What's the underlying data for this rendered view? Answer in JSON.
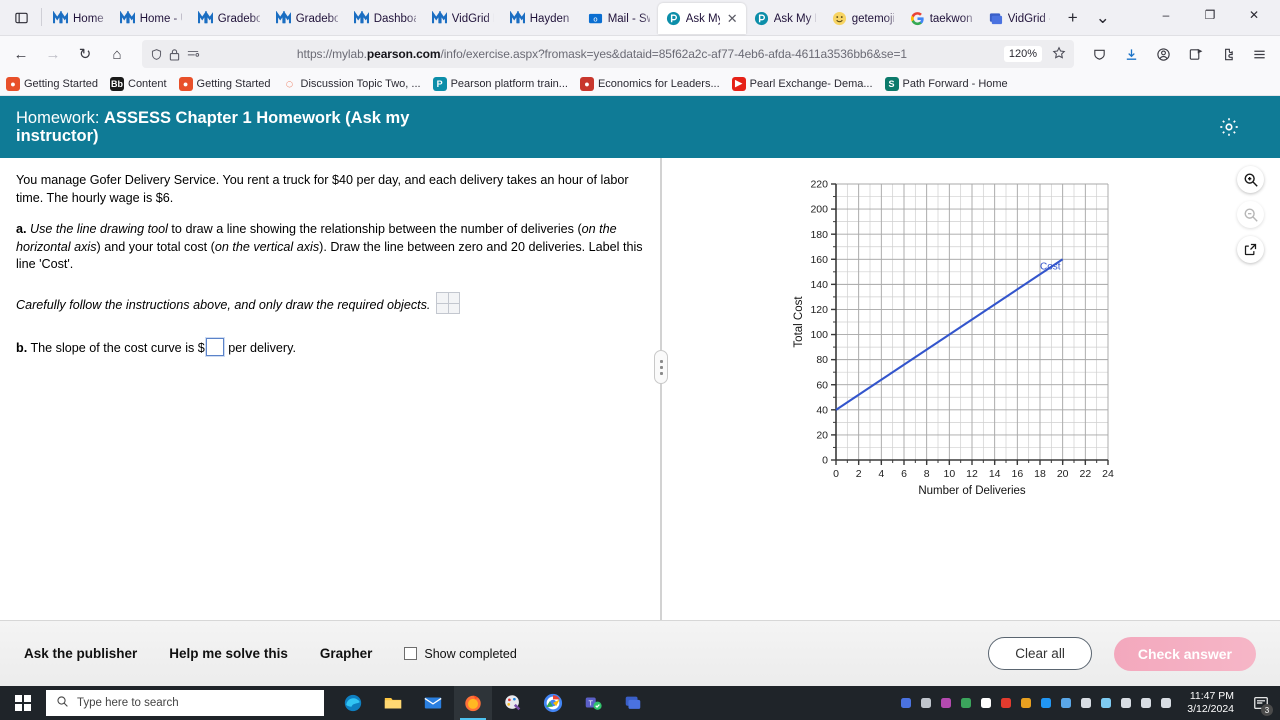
{
  "browser": {
    "tab_list_icon": "tab-list-icon",
    "tabs": [
      {
        "label": "Home",
        "icon": "mcgraw-icon",
        "active": false
      },
      {
        "label": "Home - U",
        "icon": "mcgraw-icon",
        "active": false
      },
      {
        "label": "Gradeboo",
        "icon": "mcgraw-icon",
        "active": false
      },
      {
        "label": "Gradeboo",
        "icon": "mcgraw-icon",
        "active": false
      },
      {
        "label": "Dashboar",
        "icon": "mcgraw-icon",
        "active": false
      },
      {
        "label": "VidGrid P",
        "icon": "mcgraw-icon",
        "active": false
      },
      {
        "label": "Hayden B",
        "icon": "mcgraw-icon",
        "active": false
      },
      {
        "label": "Mail - Sw",
        "icon": "outlook-icon",
        "active": false
      },
      {
        "label": "Ask My",
        "icon": "pearson-icon",
        "active": true
      },
      {
        "label": "Ask My In",
        "icon": "pearson-icon",
        "active": false
      },
      {
        "label": "getemoji",
        "icon": "emoji-icon",
        "active": false
      },
      {
        "label": "taekwond",
        "icon": "google-icon",
        "active": false
      },
      {
        "label": "VidGrid -",
        "icon": "vidgrid-icon",
        "active": false
      }
    ],
    "new_tab_label": "+",
    "tab_menu_label": "⌄",
    "window_controls": {
      "minimize": "–",
      "maximize": "❐",
      "close": "✕"
    },
    "nav": {
      "back": "←",
      "forward": "→",
      "reload": "↻",
      "home": "⌂"
    },
    "url": {
      "protocol": "https://mylab.",
      "domain": "pearson.com",
      "path": "/info/exercise.aspx?fromask=yes&dataid=85f62a2c-af77-4eb6-afda-4611a3536bb6&se=1",
      "full": "https://mylab.pearson.com/info/exercise.aspx?fromask=yes&dataid=85f62a2c-af77-4eb6-afda-4611a3536bb6&se=1"
    },
    "zoom_level": "120%",
    "bookmark_star": "bookmark-star-icon",
    "toolbar_icons": [
      "shield-icon",
      "downloads-icon",
      "account-icon",
      "extension-badge-icon",
      "extensions-icon",
      "menu-icon"
    ],
    "bookmarks": [
      {
        "label": "Getting Started",
        "icon": "firefox-icon",
        "color": "#e8502a"
      },
      {
        "label": "Content",
        "icon": "blackboard-icon",
        "color": "#1a1a1a"
      },
      {
        "label": "Getting Started",
        "icon": "firefox-icon",
        "color": "#e8502a"
      },
      {
        "label": "Discussion Topic Two, ...",
        "icon": "loading-icon",
        "color": "#e8502a"
      },
      {
        "label": "Pearson platform train...",
        "icon": "pearson-icon",
        "color": "#0c8ea9"
      },
      {
        "label": "Economics for Leaders...",
        "icon": "apple-icon",
        "color": "#c8372d"
      },
      {
        "label": "Pearl Exchange- Dema...",
        "icon": "youtube-icon",
        "color": "#e62117"
      },
      {
        "label": "Path Forward - Home",
        "icon": "sharepoint-icon",
        "color": "#0c7a6b"
      }
    ]
  },
  "app_header": {
    "label_lead": "Homework:",
    "title": "ASSESS Chapter 1 Homework (Ask my instructor)",
    "settings_icon": "gear-icon",
    "background_color": "#0f7b96"
  },
  "question": {
    "intro": "You manage Gofer Delivery Service. You rent a truck for $40 per day, and each delivery takes an hour of labor time. The hourly wage is $6.",
    "part_a_label": "a.",
    "part_a_tool": "Use the line drawing tool",
    "part_a_text_1": " to draw a line showing the relationship between the number of deliveries (",
    "part_a_em_1": "on the horizontal axis",
    "part_a_text_2": ") and your total cost (",
    "part_a_em_2": "on the vertical axis",
    "part_a_text_3": "). Draw the line between zero and 20 deliveries. Label this line 'Cost'.",
    "caution": "Carefully follow the instructions above, and only draw the required objects.",
    "drawing_tool_icon": "grid-drawing-tool-icon",
    "part_b_label": "b.",
    "part_b_text_before": "The slope of the cost curve is $",
    "part_b_value": "",
    "part_b_text_after": " per delivery."
  },
  "splitter": {
    "grip_icon": "splitter-grip-icon"
  },
  "graph_tools": [
    {
      "name": "zoom-in-icon",
      "glyph": "zoom-in",
      "disabled": false
    },
    {
      "name": "zoom-out-icon",
      "glyph": "zoom-out",
      "disabled": true
    },
    {
      "name": "expand-icon",
      "glyph": "expand",
      "disabled": false
    }
  ],
  "chart_data": {
    "type": "line",
    "title": "",
    "xlabel": "Number of Deliveries",
    "ylabel": "Total Cost",
    "xlim": [
      0,
      24
    ],
    "ylim": [
      0,
      220
    ],
    "xticks": [
      0,
      2,
      4,
      6,
      8,
      10,
      12,
      14,
      16,
      18,
      20,
      22,
      24
    ],
    "yticks": [
      0,
      20,
      40,
      60,
      80,
      100,
      120,
      140,
      160,
      180,
      200,
      220
    ],
    "x_minor_step": 1,
    "y_minor_step": 10,
    "grid": true,
    "legend": "none",
    "series": [
      {
        "name": "Cost",
        "color": "#3355cc",
        "label": "Cost",
        "label_x": 18.0,
        "label_y": 152,
        "points": [
          {
            "x": 0,
            "y": 40
          },
          {
            "x": 20,
            "y": 160
          }
        ],
        "slope": 6,
        "intercept": 40
      }
    ]
  },
  "bottom_bar": {
    "links": [
      {
        "label": "Ask the publisher"
      },
      {
        "label": "Help me solve this"
      },
      {
        "label": "Grapher"
      }
    ],
    "show_completed_label": "Show completed",
    "show_completed_checked": false,
    "clear_all_label": "Clear all",
    "check_answer_label": "Check answer",
    "check_answer_color": "#f4aec0"
  },
  "taskbar": {
    "start_icon": "windows-start-icon",
    "search_placeholder": "Type here to search",
    "search_icon": "search-icon",
    "apps": [
      {
        "name": "edge-icon",
        "active": false
      },
      {
        "name": "file-explorer-icon",
        "active": false
      },
      {
        "name": "mail-icon",
        "active": false
      },
      {
        "name": "firefox-icon",
        "active": true
      },
      {
        "name": "paint-icon",
        "active": false
      },
      {
        "name": "chrome-icon",
        "active": false
      },
      {
        "name": "teams-icon",
        "active": false
      },
      {
        "name": "vidgrid-icon",
        "active": false
      }
    ],
    "tray_icons": [
      "vidgrid-tray-icon",
      "printer-icon",
      "scissors-icon",
      "shield-icon",
      "chrome-update-icon",
      "security-icon",
      "warning-shield-icon",
      "bluetooth-icon",
      "network-install-icon",
      "microphone-icon",
      "onedrive-icon",
      "battery-icon",
      "wifi-icon",
      "volume-icon"
    ],
    "time": "11:47 PM",
    "date": "3/12/2024",
    "notification_count": "3",
    "notification_icon": "action-center-icon"
  }
}
